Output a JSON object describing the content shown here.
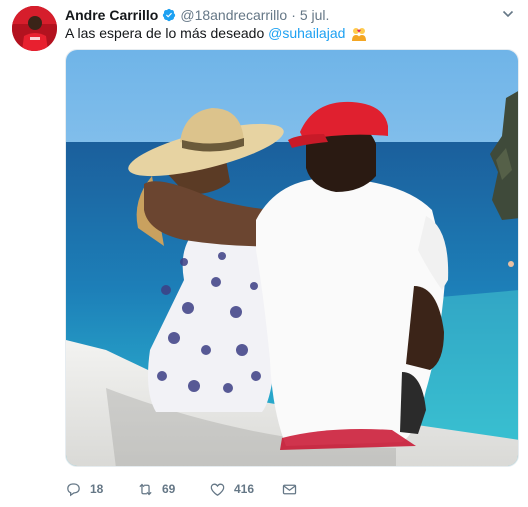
{
  "author": {
    "display_name": "Andre Carrillo",
    "handle": "@18andrecarrillo",
    "separator": "·",
    "date": "5 jul."
  },
  "tweet": {
    "text": "A las espera de lo más deseado ",
    "mention": "@suhailajad",
    "emoji": "couple-with-heart"
  },
  "actions": {
    "reply_count": "18",
    "retweet_count": "69",
    "like_count": "416"
  },
  "colors": {
    "accent": "#1da1f2",
    "muted": "#657786",
    "verified": "#1da1f2",
    "avatar_bg": "#c8102e"
  },
  "media": {
    "description_icon": "photo"
  }
}
